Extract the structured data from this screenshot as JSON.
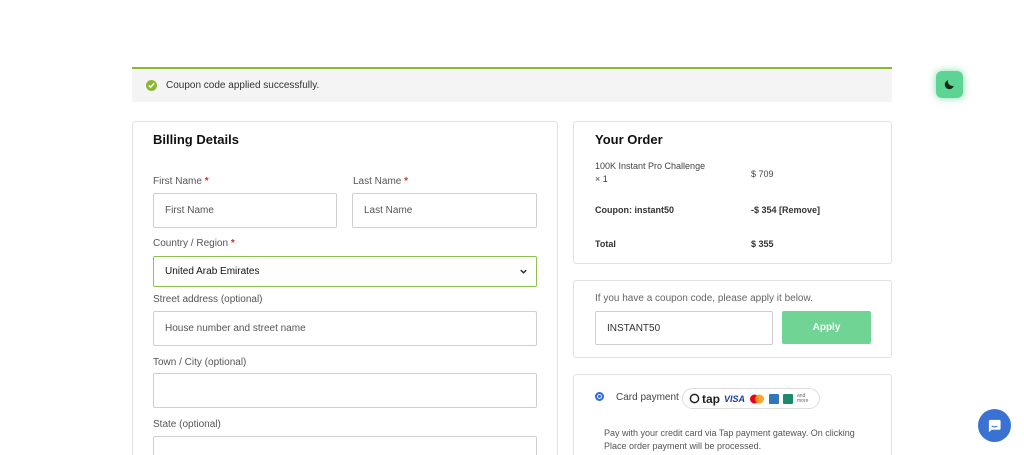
{
  "notice": {
    "message": "Coupon code applied successfully.",
    "icon": "check-circle-icon",
    "color": "#8bb82f"
  },
  "theme_toggle": {
    "icon": "moon-icon",
    "color": "#5ed494"
  },
  "billing": {
    "title": "Billing Details",
    "first_name": {
      "label": "First Name",
      "required": "*",
      "placeholder": "First Name",
      "value": ""
    },
    "last_name": {
      "label": "Last Name",
      "required": "*",
      "placeholder": "Last Name",
      "value": ""
    },
    "country": {
      "label": "Country / Region",
      "required": "*",
      "value": "United Arab Emirates"
    },
    "street": {
      "label": "Street address (optional)",
      "placeholder": "House number and street name",
      "value": ""
    },
    "city": {
      "label": "Town / City (optional)",
      "placeholder": "",
      "value": ""
    },
    "state": {
      "label": "State (optional)",
      "placeholder": "",
      "value": ""
    }
  },
  "order": {
    "title": "Your Order",
    "item_name": "100K Instant Pro Challenge",
    "item_qty": "× 1",
    "item_price": "$ 709",
    "coupon_label": "Coupon: instant50",
    "coupon_amount": "-$ 354",
    "remove_label": "[Remove]",
    "total_label": "Total",
    "total_value": "$ 355"
  },
  "coupon": {
    "hint": "If you have a coupon code, please apply it below.",
    "code_value": "INSTANT50",
    "apply_label": "Apply",
    "apply_color": "#6fd494"
  },
  "payment": {
    "method_label": "Card payment",
    "tap_label": "tap",
    "visa_label": "VISA",
    "more_label": "and more",
    "description": "Pay with your credit card via Tap payment gateway. On clicking Place order payment will be processed."
  },
  "chat": {
    "icon": "chat-icon",
    "color": "#3a72d4"
  }
}
